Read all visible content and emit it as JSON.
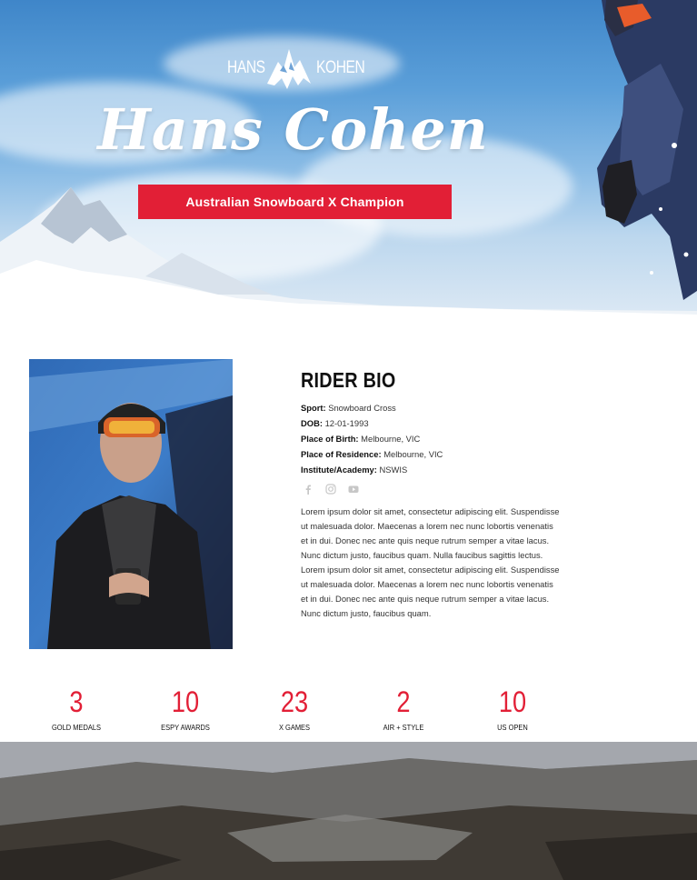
{
  "hero": {
    "logo_left": "HANS",
    "logo_right": "KOHEN",
    "title": "Hans Cohen",
    "badge": "Australian Snowboard X Champion"
  },
  "bio": {
    "heading": "RIDER BIO",
    "fields": [
      {
        "label": "Sport:",
        "value": "Snowboard Cross"
      },
      {
        "label": "DOB:",
        "value": "12-01-1993"
      },
      {
        "label": "Place of Birth:",
        "value": "Melbourne, VIC"
      },
      {
        "label": "Place of Residence:",
        "value": "Melbourne, VIC"
      },
      {
        "label": "Institute/Academy:",
        "value": "NSWIS"
      }
    ],
    "social": [
      "facebook-icon",
      "instagram-icon",
      "youtube-icon"
    ],
    "text": "Lorem ipsum dolor sit amet, consectetur adipiscing elit. Suspendisse ut malesuada dolor. Maecenas a lorem nec nunc lobortis venenatis et in dui. Donec nec ante quis neque rutrum semper a vitae lacus. Nunc dictum justo, faucibus quam. Nulla faucibus sagittis lectus. Lorem ipsum dolor sit amet, consectetur adipiscing elit. Suspendisse ut malesuada dolor. Maecenas a lorem nec nunc lobortis venenatis et in dui. Donec nec ante quis neque rutrum semper a vitae lacus. Nunc dictum justo, faucibus quam."
  },
  "stats": [
    {
      "value": "3",
      "label": "GOLD MEDALS"
    },
    {
      "value": "10",
      "label": "ESPY AWARDS"
    },
    {
      "value": "23",
      "label": "X GAMES"
    },
    {
      "value": "2",
      "label": "AIR + STYLE"
    },
    {
      "value": "10",
      "label": "US OPEN"
    }
  ],
  "colors": {
    "accent": "#e21f36",
    "text": "#111111",
    "icon_gray": "#c7c7c7"
  }
}
